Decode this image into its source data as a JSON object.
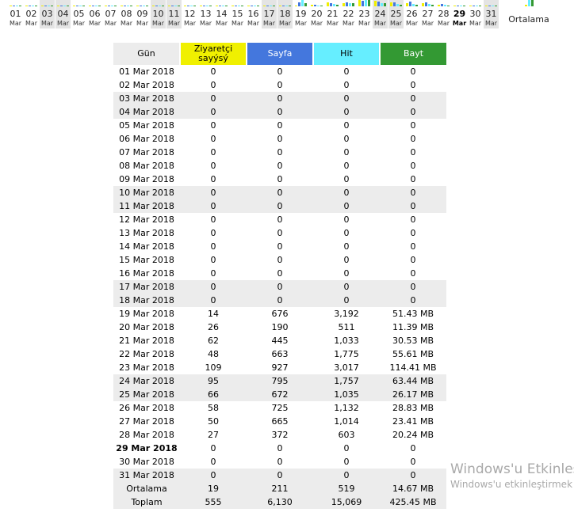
{
  "bar_colors": {
    "visits": "#f0f000",
    "pages": "#4477dd",
    "hits": "#66eeff",
    "bytes": "#339933"
  },
  "days": [
    {
      "num": "01",
      "mon": "Mar",
      "weekend": false
    },
    {
      "num": "02",
      "mon": "Mar",
      "weekend": false
    },
    {
      "num": "03",
      "mon": "Mar",
      "weekend": true
    },
    {
      "num": "04",
      "mon": "Mar",
      "weekend": true
    },
    {
      "num": "05",
      "mon": "Mar",
      "weekend": false
    },
    {
      "num": "06",
      "mon": "Mar",
      "weekend": false
    },
    {
      "num": "07",
      "mon": "Mar",
      "weekend": false
    },
    {
      "num": "08",
      "mon": "Mar",
      "weekend": false
    },
    {
      "num": "09",
      "mon": "Mar",
      "weekend": false
    },
    {
      "num": "10",
      "mon": "Mar",
      "weekend": true
    },
    {
      "num": "11",
      "mon": "Mar",
      "weekend": true
    },
    {
      "num": "12",
      "mon": "Mar",
      "weekend": false
    },
    {
      "num": "13",
      "mon": "Mar",
      "weekend": false
    },
    {
      "num": "14",
      "mon": "Mar",
      "weekend": false
    },
    {
      "num": "15",
      "mon": "Mar",
      "weekend": false
    },
    {
      "num": "16",
      "mon": "Mar",
      "weekend": false
    },
    {
      "num": "17",
      "mon": "Mar",
      "weekend": true
    },
    {
      "num": "18",
      "mon": "Mar",
      "weekend": true
    },
    {
      "num": "19",
      "mon": "Mar",
      "weekend": false
    },
    {
      "num": "20",
      "mon": "Mar",
      "weekend": false
    },
    {
      "num": "21",
      "mon": "Mar",
      "weekend": false
    },
    {
      "num": "22",
      "mon": "Mar",
      "weekend": false
    },
    {
      "num": "23",
      "mon": "Mar",
      "weekend": false
    },
    {
      "num": "24",
      "mon": "Mar",
      "weekend": true
    },
    {
      "num": "25",
      "mon": "Mar",
      "weekend": true
    },
    {
      "num": "26",
      "mon": "Mar",
      "weekend": false
    },
    {
      "num": "27",
      "mon": "Mar",
      "weekend": false
    },
    {
      "num": "28",
      "mon": "Mar",
      "weekend": false
    },
    {
      "num": "29",
      "mon": "Mar",
      "weekend": false,
      "today": true
    },
    {
      "num": "30",
      "mon": "Mar",
      "weekend": false
    },
    {
      "num": "31",
      "mon": "Mar",
      "weekend": true
    }
  ],
  "average_label": "Ortalama",
  "table": {
    "headers": {
      "day": "Gün",
      "visits": "Ziyaretçi sayýsý",
      "pages": "Sayfa",
      "hits": "Hit",
      "bytes": "Bayt"
    },
    "rows": [
      {
        "day": "01 Mar 2018",
        "visits": "0",
        "pages": "0",
        "hits": "0",
        "bytes": "0",
        "weekend": false
      },
      {
        "day": "02 Mar 2018",
        "visits": "0",
        "pages": "0",
        "hits": "0",
        "bytes": "0",
        "weekend": false
      },
      {
        "day": "03 Mar 2018",
        "visits": "0",
        "pages": "0",
        "hits": "0",
        "bytes": "0",
        "weekend": true
      },
      {
        "day": "04 Mar 2018",
        "visits": "0",
        "pages": "0",
        "hits": "0",
        "bytes": "0",
        "weekend": true
      },
      {
        "day": "05 Mar 2018",
        "visits": "0",
        "pages": "0",
        "hits": "0",
        "bytes": "0",
        "weekend": false
      },
      {
        "day": "06 Mar 2018",
        "visits": "0",
        "pages": "0",
        "hits": "0",
        "bytes": "0",
        "weekend": false
      },
      {
        "day": "07 Mar 2018",
        "visits": "0",
        "pages": "0",
        "hits": "0",
        "bytes": "0",
        "weekend": false
      },
      {
        "day": "08 Mar 2018",
        "visits": "0",
        "pages": "0",
        "hits": "0",
        "bytes": "0",
        "weekend": false
      },
      {
        "day": "09 Mar 2018",
        "visits": "0",
        "pages": "0",
        "hits": "0",
        "bytes": "0",
        "weekend": false
      },
      {
        "day": "10 Mar 2018",
        "visits": "0",
        "pages": "0",
        "hits": "0",
        "bytes": "0",
        "weekend": true
      },
      {
        "day": "11 Mar 2018",
        "visits": "0",
        "pages": "0",
        "hits": "0",
        "bytes": "0",
        "weekend": true
      },
      {
        "day": "12 Mar 2018",
        "visits": "0",
        "pages": "0",
        "hits": "0",
        "bytes": "0",
        "weekend": false
      },
      {
        "day": "13 Mar 2018",
        "visits": "0",
        "pages": "0",
        "hits": "0",
        "bytes": "0",
        "weekend": false
      },
      {
        "day": "14 Mar 2018",
        "visits": "0",
        "pages": "0",
        "hits": "0",
        "bytes": "0",
        "weekend": false
      },
      {
        "day": "15 Mar 2018",
        "visits": "0",
        "pages": "0",
        "hits": "0",
        "bytes": "0",
        "weekend": false
      },
      {
        "day": "16 Mar 2018",
        "visits": "0",
        "pages": "0",
        "hits": "0",
        "bytes": "0",
        "weekend": false
      },
      {
        "day": "17 Mar 2018",
        "visits": "0",
        "pages": "0",
        "hits": "0",
        "bytes": "0",
        "weekend": true
      },
      {
        "day": "18 Mar 2018",
        "visits": "0",
        "pages": "0",
        "hits": "0",
        "bytes": "0",
        "weekend": true
      },
      {
        "day": "19 Mar 2018",
        "visits": "14",
        "pages": "676",
        "hits": "3,192",
        "bytes": "51.43 MB",
        "weekend": false
      },
      {
        "day": "20 Mar 2018",
        "visits": "26",
        "pages": "190",
        "hits": "511",
        "bytes": "11.39 MB",
        "weekend": false
      },
      {
        "day": "21 Mar 2018",
        "visits": "62",
        "pages": "445",
        "hits": "1,033",
        "bytes": "30.53 MB",
        "weekend": false
      },
      {
        "day": "22 Mar 2018",
        "visits": "48",
        "pages": "663",
        "hits": "1,775",
        "bytes": "55.61 MB",
        "weekend": false
      },
      {
        "day": "23 Mar 2018",
        "visits": "109",
        "pages": "927",
        "hits": "3,017",
        "bytes": "114.41 MB",
        "weekend": false
      },
      {
        "day": "24 Mar 2018",
        "visits": "95",
        "pages": "795",
        "hits": "1,757",
        "bytes": "63.44 MB",
        "weekend": true
      },
      {
        "day": "25 Mar 2018",
        "visits": "66",
        "pages": "672",
        "hits": "1,035",
        "bytes": "26.17 MB",
        "weekend": true
      },
      {
        "day": "26 Mar 2018",
        "visits": "58",
        "pages": "725",
        "hits": "1,132",
        "bytes": "28.83 MB",
        "weekend": false
      },
      {
        "day": "27 Mar 2018",
        "visits": "50",
        "pages": "665",
        "hits": "1,014",
        "bytes": "23.41 MB",
        "weekend": false
      },
      {
        "day": "28 Mar 2018",
        "visits": "27",
        "pages": "372",
        "hits": "603",
        "bytes": "20.24 MB",
        "weekend": false
      },
      {
        "day": "29 Mar 2018",
        "visits": "0",
        "pages": "0",
        "hits": "0",
        "bytes": "0",
        "weekend": false,
        "today": true
      },
      {
        "day": "30 Mar 2018",
        "visits": "0",
        "pages": "0",
        "hits": "0",
        "bytes": "0",
        "weekend": false
      },
      {
        "day": "31 Mar 2018",
        "visits": "0",
        "pages": "0",
        "hits": "0",
        "bytes": "0",
        "weekend": true
      }
    ],
    "average": {
      "day": "Ortalama",
      "visits": "19",
      "pages": "211",
      "hits": "519",
      "bytes": "14.67 MB"
    },
    "total": {
      "day": "Toplam",
      "visits": "555",
      "pages": "6,130",
      "hits": "15,069",
      "bytes": "425.45 MB"
    }
  },
  "watermark": {
    "line1": "Windows'u Etkinleştir",
    "line2": "Windows'u etkinleştirmek için Ayarlar'a gidin."
  }
}
